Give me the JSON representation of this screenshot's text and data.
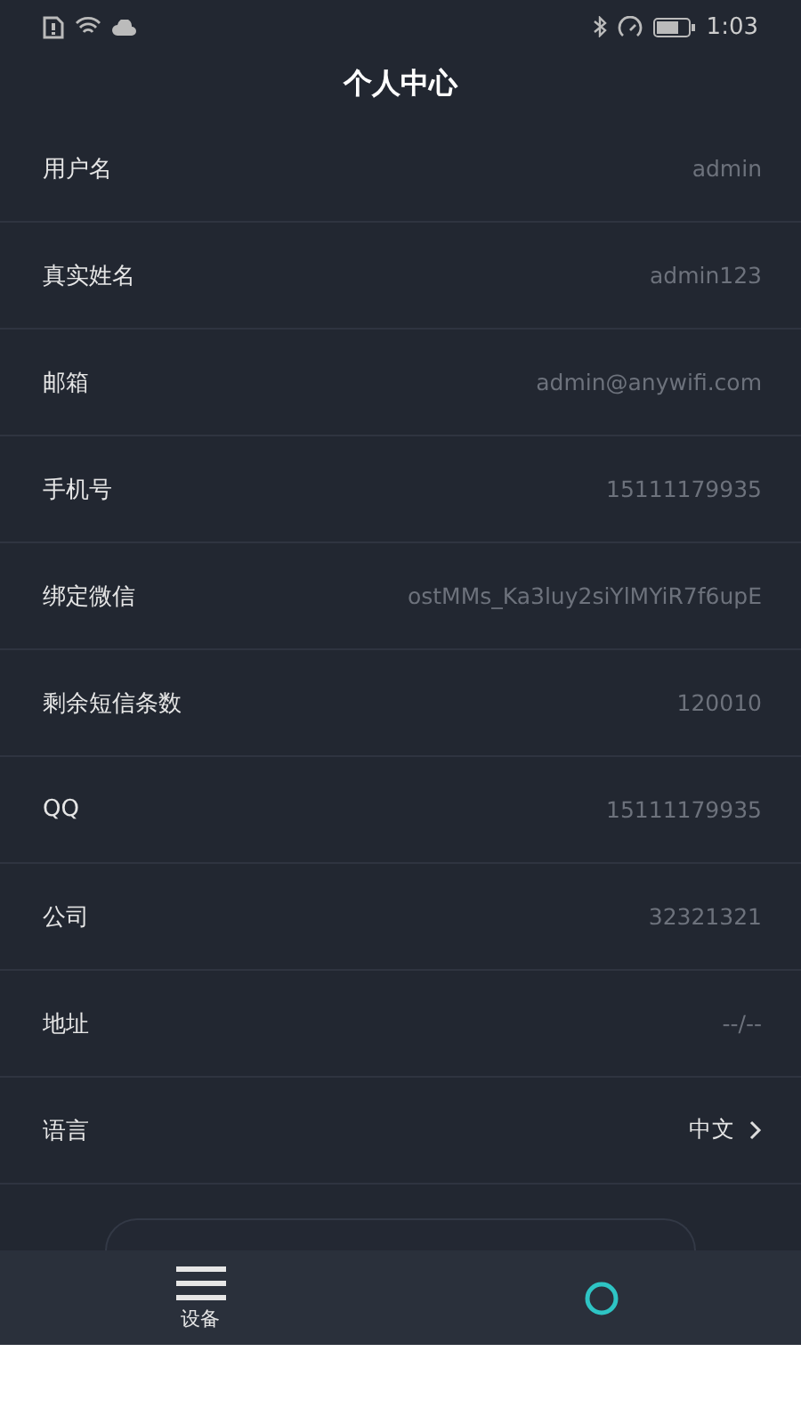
{
  "status_bar": {
    "time": "1:03"
  },
  "header": {
    "title": "个人中心"
  },
  "rows": [
    {
      "label": "用户名",
      "value": "admin",
      "kind": "info"
    },
    {
      "label": "真实姓名",
      "value": "admin123",
      "kind": "info"
    },
    {
      "label": "邮箱",
      "value": "admin@anywifi.com",
      "kind": "info"
    },
    {
      "label": "手机号",
      "value": "15111179935",
      "kind": "info"
    },
    {
      "label": "绑定微信",
      "value": "ostMMs_Ka3luy2siYlMYiR7f6upE",
      "kind": "info"
    },
    {
      "label": "剩余短信条数",
      "value": "120010",
      "kind": "info"
    },
    {
      "label": "QQ",
      "value": "15111179935",
      "kind": "info"
    },
    {
      "label": "公司",
      "value": "32321321",
      "kind": "info"
    },
    {
      "label": "地址",
      "value": "--/--",
      "kind": "info"
    },
    {
      "label": "语言",
      "value": "中文",
      "kind": "link"
    }
  ],
  "tab_bar": [
    {
      "label": "设备",
      "kind": "menu",
      "selected": false
    },
    {
      "kind": "circle",
      "selected": true
    }
  ]
}
